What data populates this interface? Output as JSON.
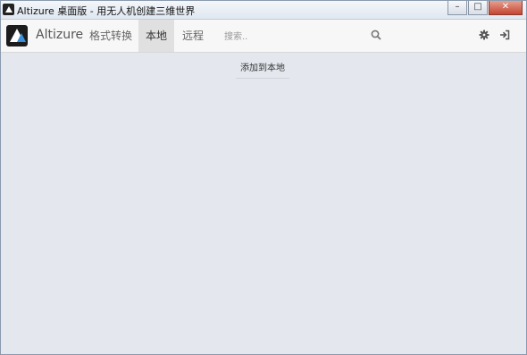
{
  "window": {
    "title": "Altizure 桌面版 - 用无人机创建三维世界",
    "controls": {
      "minimize": "–",
      "maximize": "□",
      "close": "✕"
    }
  },
  "navbar": {
    "brand": "Altizure",
    "items": [
      {
        "label": "格式转换",
        "active": false
      },
      {
        "label": "本地",
        "active": true
      },
      {
        "label": "远程",
        "active": false
      }
    ],
    "search_placeholder": "搜索.."
  },
  "main": {
    "add_local_label": "添加到本地"
  }
}
